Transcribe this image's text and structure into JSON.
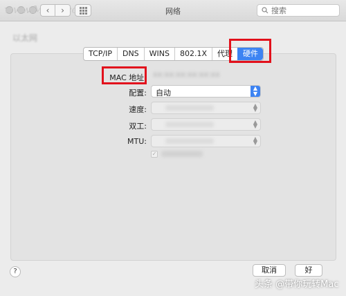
{
  "window": {
    "title": "网络",
    "watermark": "www.MacZ.com",
    "breadcrumb": "以太网"
  },
  "toolbar": {
    "back_icon": "chevron-left-icon",
    "forward_icon": "chevron-right-icon",
    "grid_icon": "grid-icon"
  },
  "search": {
    "placeholder": "搜索"
  },
  "tabs": [
    {
      "label": "TCP/IP"
    },
    {
      "label": "DNS"
    },
    {
      "label": "WINS"
    },
    {
      "label": "802.1X"
    },
    {
      "label": "代理"
    },
    {
      "label": "硬件",
      "active": true
    }
  ],
  "form": {
    "mac": {
      "label": "MAC 地址:"
    },
    "config": {
      "label": "配置:",
      "value": "自动"
    },
    "speed": {
      "label": "速度:"
    },
    "duplex": {
      "label": "双工:"
    },
    "mtu": {
      "label": "MTU:"
    }
  },
  "buttons": {
    "help": "?",
    "cancel": "取消",
    "ok": "好"
  },
  "footer": {
    "brand": "头条 @带你玩转Mac"
  },
  "colors": {
    "accent": "#3d83f2",
    "annotation": "#e2111c"
  }
}
